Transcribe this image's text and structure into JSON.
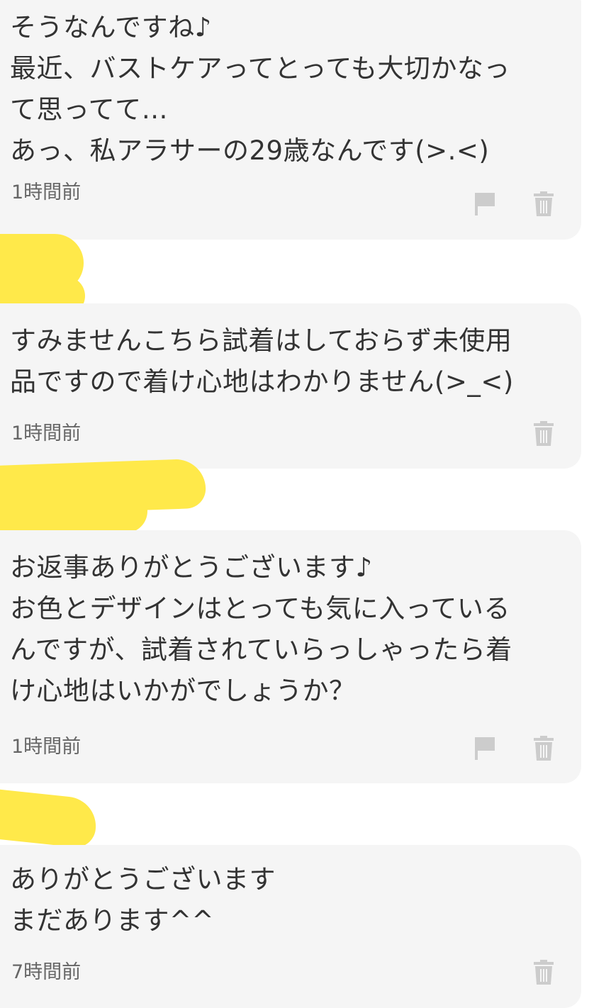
{
  "comments": [
    {
      "message": "そうなんですね♪\n最近、バストケアってとっても大切かなっ\nて思ってて…\nあっ、私アラサーの29歳なんです(>.<)",
      "time": "1時間前",
      "has_report": true,
      "has_delete": true
    },
    {
      "message": "すみませんこちら試着はしておらず未使用\n品ですので着け心地はわかりません(>_<)",
      "time": "1時間前",
      "has_report": false,
      "has_delete": true
    },
    {
      "message": "お返事ありがとうございます♪\nお色とデザインはとっても気に入っている\nんですが、試着されていらっしゃったら着\nけ心地はいかがでしょうか？",
      "time": "1時間前",
      "has_report": true,
      "has_delete": true
    },
    {
      "message": "ありがとうございます\nまだあります^^",
      "time": "7時間前",
      "has_report": false,
      "has_delete": true
    }
  ],
  "icons": {
    "report": "flag-icon",
    "delete": "trash-icon"
  },
  "colors": {
    "bubble_bg": "#f5f5f5",
    "text": "#333333",
    "time": "#666666",
    "icon": "#cccccc",
    "highlight": "#ffe94a"
  }
}
